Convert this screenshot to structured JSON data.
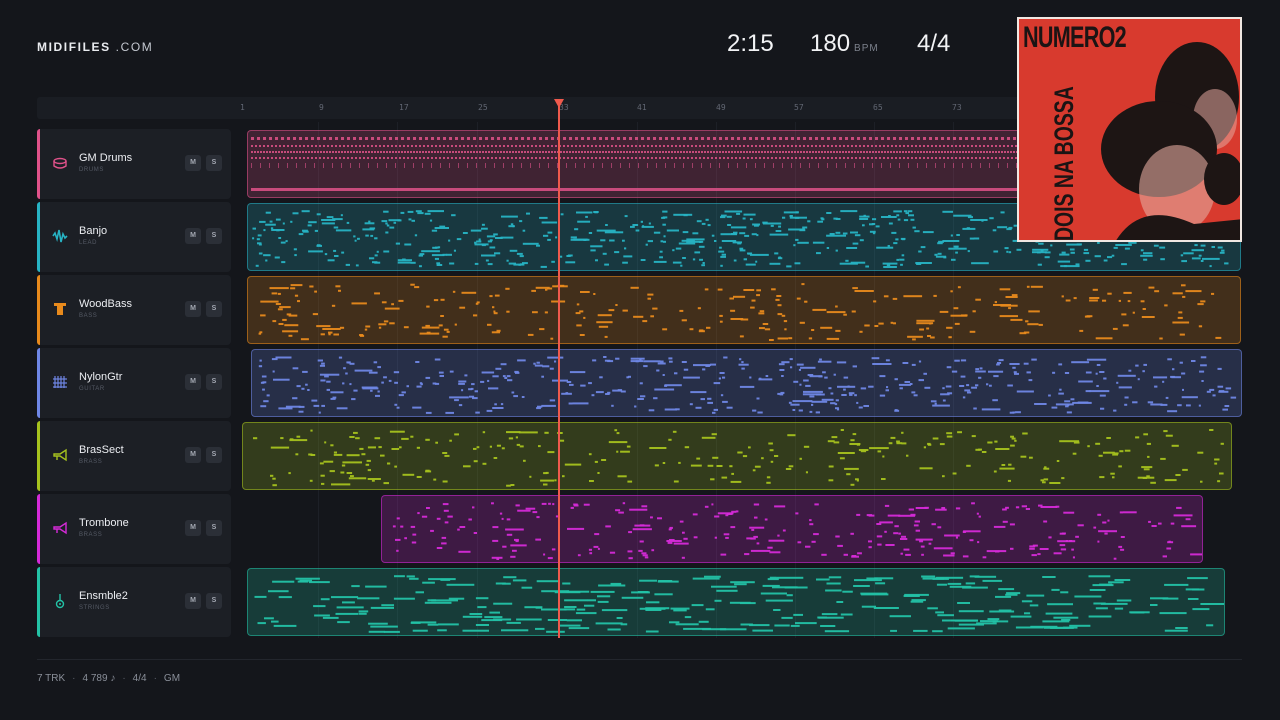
{
  "brand": {
    "bold": "MIDIFILES",
    "light": ".COM"
  },
  "transport": {
    "time": "2:15",
    "bpm": "180",
    "bpm_unit": "BPM",
    "signature": "4/4"
  },
  "ruler": {
    "ticks": [
      "1",
      "9",
      "17",
      "25",
      "33",
      "41",
      "49",
      "57",
      "65",
      "73"
    ]
  },
  "playhead": {
    "bar": 33
  },
  "cover": {
    "title": "NUMERO2",
    "subtitle": "DOIS NA BOSSA"
  },
  "tracks": [
    {
      "name": "GM Drums",
      "role": "DRUMS",
      "color": "#e0528a",
      "icon": "drum-icon",
      "mute": "M",
      "solo": "S"
    },
    {
      "name": "Banjo",
      "role": "LEAD",
      "color": "#27b3c4",
      "icon": "waveform-icon",
      "mute": "M",
      "solo": "S"
    },
    {
      "name": "WoodBass",
      "role": "BASS",
      "color": "#e88a1c",
      "icon": "bass-icon",
      "mute": "M",
      "solo": "S"
    },
    {
      "name": "NylonGtr",
      "role": "GUITAR",
      "color": "#6f87e6",
      "icon": "guitar-icon",
      "mute": "M",
      "solo": "S"
    },
    {
      "name": "BrasSect",
      "role": "BRASS",
      "color": "#a6c21e",
      "icon": "horn-icon",
      "mute": "M",
      "solo": "S"
    },
    {
      "name": "Trombone",
      "role": "BRASS",
      "color": "#d52ad8",
      "icon": "horn-icon",
      "mute": "M",
      "solo": "S"
    },
    {
      "name": "Ensmble2",
      "role": "STRINGS",
      "color": "#23c2a6",
      "icon": "strings-icon",
      "mute": "M",
      "solo": "S"
    }
  ],
  "footer": {
    "tracks": "7 TRK",
    "notes": "4 789 ♪",
    "signature": "4/4",
    "standard": "GM"
  }
}
